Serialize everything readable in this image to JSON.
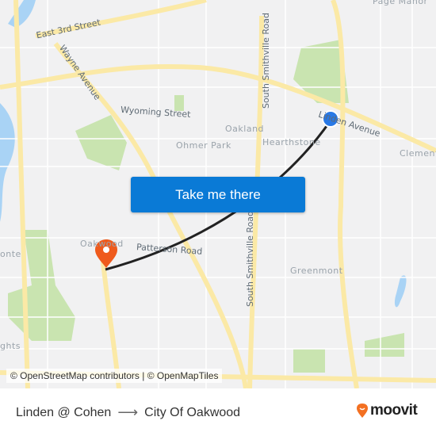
{
  "map": {
    "labels": {
      "east_3rd": "East 3rd Street",
      "wayne": "Wayne Avenue",
      "wyoming": "Wyoming Street",
      "smithville_n": "South Smithville Road",
      "smithville_s": "South Smithville Road",
      "linden": "Linden Avenue",
      "patterson": "Patterson Road",
      "oakland": "Oakland",
      "ohmer": "Ohmer Park",
      "hearthstone": "Hearthstone",
      "clement": "Clement",
      "greenmont": "Greenmont",
      "oakwood": "Oakwood",
      "page_manor": "Page Manor",
      "monte": "onte",
      "heights": "ghts"
    },
    "origin_marker": "Linden @ Cohen",
    "destination_marker": "City Of Oakwood",
    "colors": {
      "route": "#222222",
      "origin": "#2979e6",
      "destination": "#ef5a1c",
      "road_major": "#fbe9a6",
      "park": "#c9e4b0",
      "water": "#a9d3f5"
    }
  },
  "cta": {
    "label": "Take me there"
  },
  "attribution": "© OpenStreetMap contributors | © OpenMapTiles",
  "footer": {
    "from": "Linden @ Cohen",
    "arrow": "⟶",
    "to": "City Of Oakwood",
    "brand": "moovit"
  }
}
